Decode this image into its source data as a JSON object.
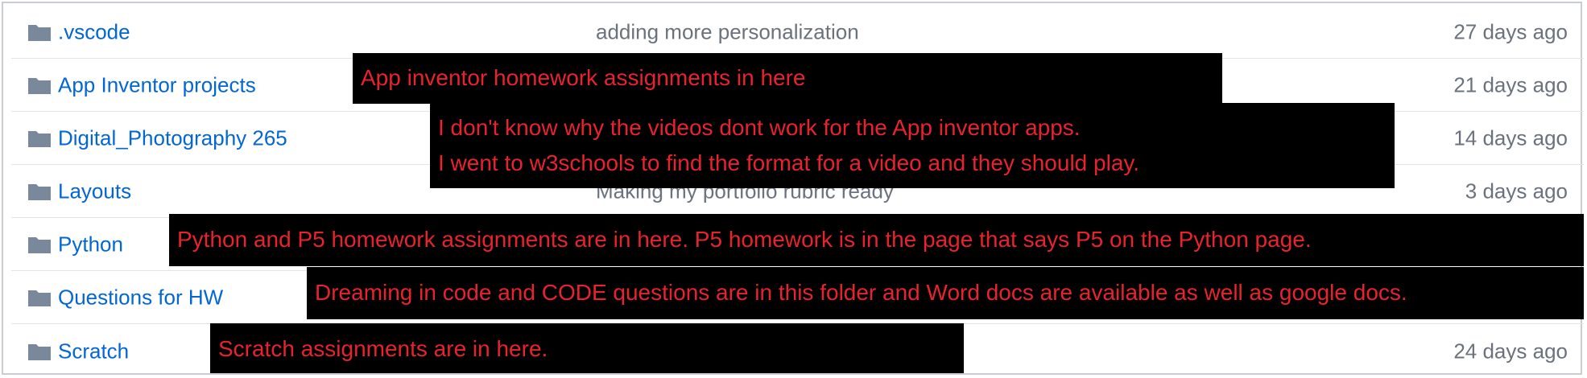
{
  "rows": [
    {
      "name": ".vscode",
      "message": "adding more personalization",
      "age": "27 days ago"
    },
    {
      "name": "App Inventor projects",
      "message": "",
      "age": "21 days ago"
    },
    {
      "name": "Digital_Photography 265",
      "message": "",
      "age": "14 days ago"
    },
    {
      "name": "Layouts",
      "message": "Making my portfolio rubric ready",
      "age": "3 days ago"
    },
    {
      "name": "Python",
      "message": "",
      "age": ""
    },
    {
      "name": "Questions for HW",
      "message": "",
      "age": ""
    },
    {
      "name": "Scratch",
      "message": "",
      "age": "24 days ago"
    }
  ],
  "annotations": [
    {
      "lines": [
        "App inventor homework assignments in here"
      ]
    },
    {
      "lines": [
        "I don't know why the videos dont work for the App inventor apps.",
        "I went to w3schools to find the format for a video and they should play."
      ]
    },
    {
      "lines": [
        "Python and P5 homework assignments are in here. P5 homework is in the page that says P5 on the Python page."
      ]
    },
    {
      "lines": [
        "Dreaming in code and CODE questions are in this folder and Word docs are available as well as google docs."
      ]
    },
    {
      "lines": [
        "Scratch assignments are in here."
      ]
    }
  ],
  "icons": {
    "folder": "folder-icon"
  },
  "colors": {
    "link": "#0366d6",
    "muted": "#6a737d",
    "folder": "#79889a",
    "annotation_bg": "#000000",
    "annotation_text": "#e8222e"
  }
}
